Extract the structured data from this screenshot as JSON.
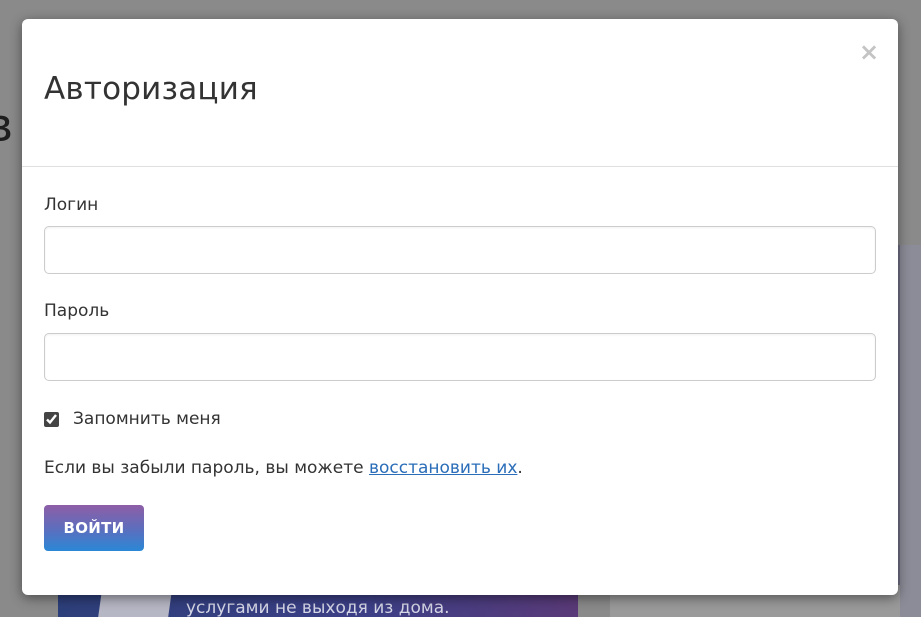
{
  "background": {
    "heading_fragment": "в",
    "banner_text": "услугами не выходя из дома."
  },
  "modal": {
    "title": "Авторизация",
    "close_label": "×",
    "login": {
      "label": "Логин",
      "value": "",
      "placeholder": ""
    },
    "password": {
      "label": "Пароль",
      "value": "",
      "placeholder": ""
    },
    "remember": {
      "label": "Запомнить меня",
      "checked": true
    },
    "forgot": {
      "prefix": "Если вы забыли пароль, вы можете ",
      "link": "восстановить их",
      "suffix": "."
    },
    "submit_label": "ВОЙТИ"
  },
  "colors": {
    "link": "#2a6db8",
    "button_gradient_top": "#8e5ea6",
    "button_gradient_bottom": "#2a88d6",
    "overlay": "#7d7d7d"
  }
}
